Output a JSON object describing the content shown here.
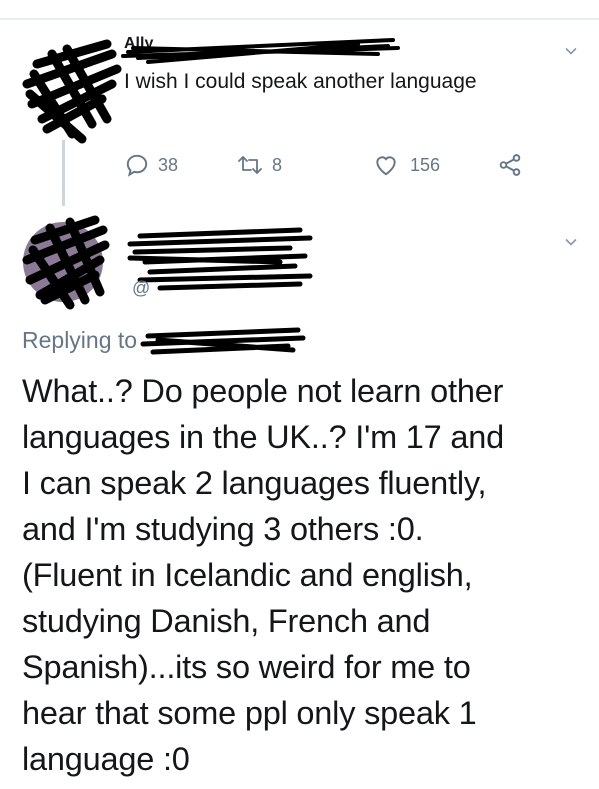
{
  "tweet1": {
    "text": "I wish I could speak another language",
    "name_redacted": "Ally",
    "actions": {
      "replies": "38",
      "retweets": "8",
      "likes": "156"
    }
  },
  "tweet2": {
    "replying_to_label": "Replying to",
    "handle_prefix": "@",
    "text": "What..? Do people not learn other\nlanguages in the UK..? I'm 17 and\nI can speak 2 languages fluently,\nand I'm studying 3 others :0.\n(Fluent in Icelandic and english,\nstudying Danish, French and\nSpanish)...its so weird for me to\nhear that some ppl only speak 1\nlanguage :0"
  },
  "icons": {
    "reply": "reply-icon",
    "retweet": "retweet-icon",
    "like": "heart-icon",
    "share": "share-icon",
    "more": "chevron-down-icon"
  },
  "colors": {
    "text": "#14171a",
    "muted": "#657786",
    "divider": "#e6ecf0",
    "thread": "#ccd6dd"
  }
}
